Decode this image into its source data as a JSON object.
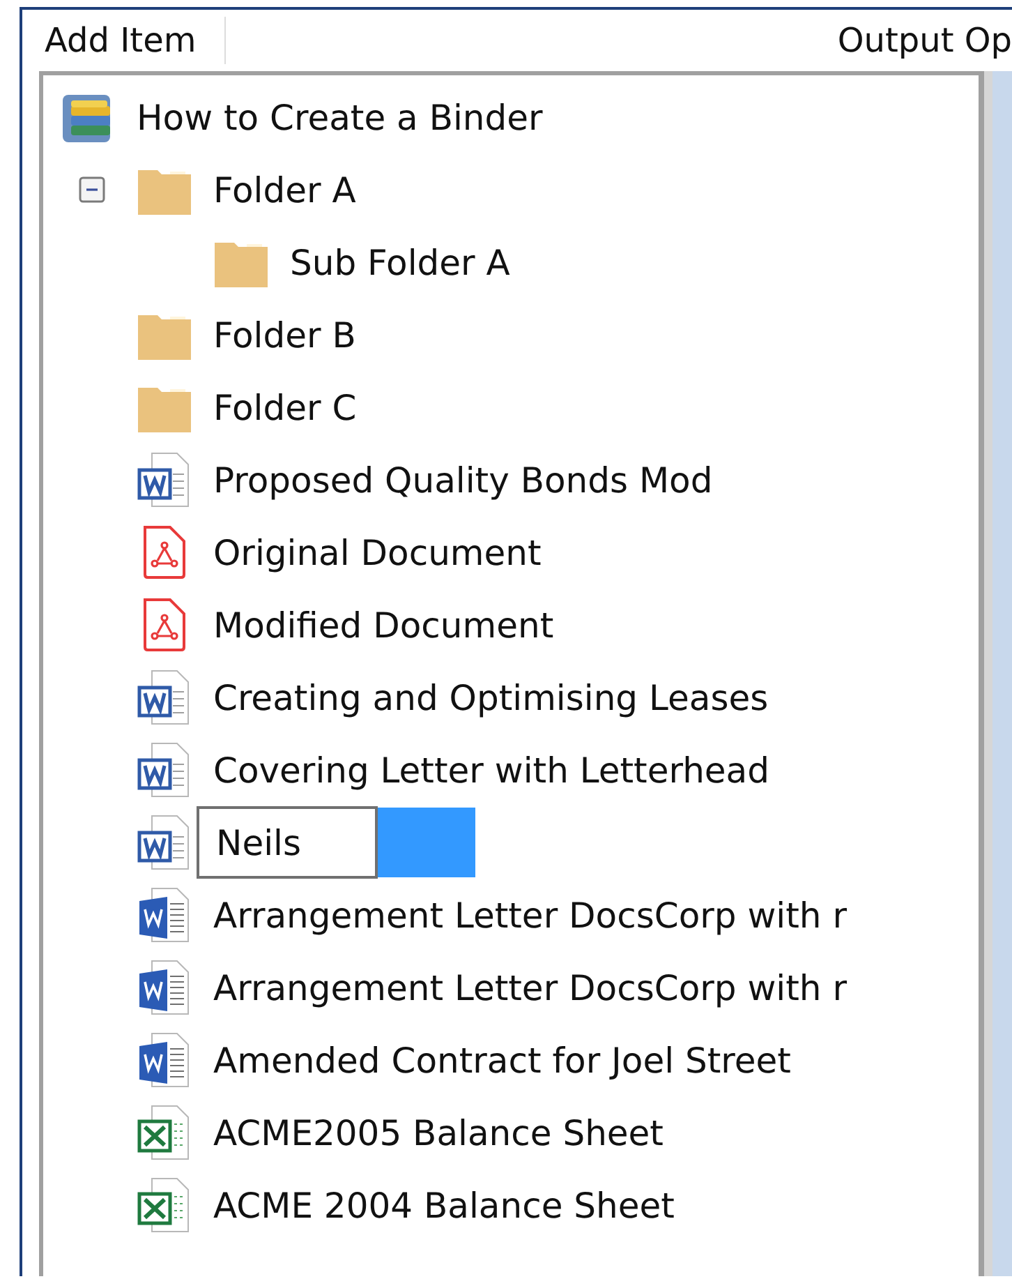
{
  "toolbar": {
    "items": [
      "Add Item",
      "Output Op"
    ]
  },
  "tree": {
    "label": "How to Create a Binder",
    "kind": "binder",
    "children": [
      {
        "label": "Folder A",
        "kind": "folder",
        "expanded": true,
        "editing": false,
        "children": [
          {
            "label": "Sub Folder A",
            "kind": "folder",
            "editing": false
          }
        ]
      },
      {
        "label": "Folder B",
        "kind": "folder",
        "editing": false
      },
      {
        "label": "Folder C",
        "kind": "folder",
        "editing": false
      },
      {
        "label": "Proposed Quality Bonds Mod",
        "kind": "doc",
        "editing": false
      },
      {
        "label": "Original Document",
        "kind": "pdf",
        "editing": false
      },
      {
        "label": "Modified Document",
        "kind": "pdf",
        "editing": false
      },
      {
        "label": "Creating and Optimising Leases",
        "kind": "doc",
        "editing": false
      },
      {
        "label": "Covering Letter with Letterhead",
        "kind": "doc",
        "editing": false
      },
      {
        "label": "Neils",
        "kind": "doc",
        "editing": true
      },
      {
        "label": "Arrangement Letter DocsCorp with r",
        "kind": "docx",
        "editing": false
      },
      {
        "label": "Arrangement Letter DocsCorp with r",
        "kind": "docx",
        "editing": false
      },
      {
        "label": "Amended Contract for Joel Street",
        "kind": "docx",
        "editing": false
      },
      {
        "label": "ACME2005 Balance Sheet",
        "kind": "xlsx",
        "editing": false
      },
      {
        "label": "ACME 2004 Balance Sheet",
        "kind": "xlsx",
        "editing": false
      }
    ]
  }
}
